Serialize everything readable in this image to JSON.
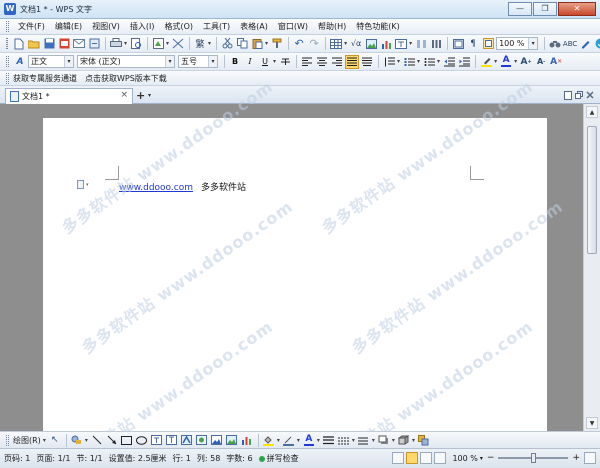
{
  "window": {
    "app_icon": "W",
    "title": "文档1 * - WPS 文字",
    "controls": [
      "—",
      "❐",
      "✕"
    ]
  },
  "menu": {
    "items": [
      "文件(F)",
      "编辑(E)",
      "视图(V)",
      "插入(I)",
      "格式(O)",
      "工具(T)",
      "表格(A)",
      "窗口(W)",
      "帮助(H)",
      "特色功能(K)"
    ]
  },
  "toolbar": {
    "zoom_value": "100 %"
  },
  "format_bar": {
    "style": "正文",
    "font": "宋体 (正文)",
    "size": "五号",
    "bold": "B",
    "italic": "I",
    "underline": "U",
    "font_color_label": "A"
  },
  "links_bar": {
    "link1": "获取专属服务通道",
    "link2": "点击获取WPS版本下载"
  },
  "tabs": {
    "active_tab": "文档1 *",
    "close": "×",
    "new_tab": "+"
  },
  "document": {
    "link_text": "www.ddooo.com",
    "text": "多多软件站",
    "watermark": "多多软件站 www.ddooo.com"
  },
  "drawbar": {
    "label": "绘图(R)"
  },
  "status": {
    "page_num": "页码: 1",
    "pages": "页面: 1/1",
    "section": "节: 1/1",
    "setting": "设置值: 2.5厘米",
    "row": "行: 1",
    "col": "列: 58",
    "chars": "字数: 6",
    "spell": "拼写检查",
    "zoom": "100 %"
  },
  "colors": {
    "title_bar": "#cfe3f4",
    "link": "#1f38d8",
    "workspace": "#8e8e8e",
    "active_view": "#ffd86b"
  }
}
